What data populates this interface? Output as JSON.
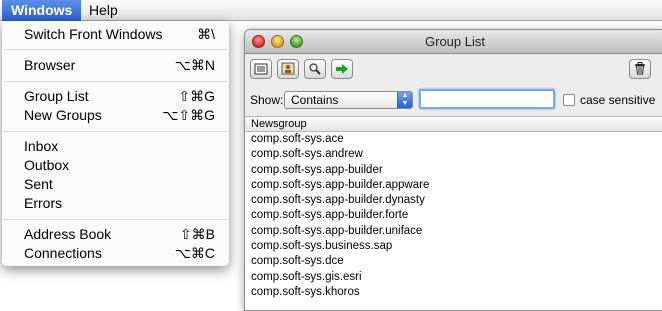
{
  "menubar": {
    "windows": "Windows",
    "help": "Help"
  },
  "window": {
    "title": "Group List",
    "show_label": "Show:",
    "show_value": "Contains",
    "search_value": "",
    "case_sensitive_label": "case sensitive",
    "column_header": "Newsgroup",
    "rows": [
      "comp.soft-sys.ace",
      "comp.soft-sys.andrew",
      "comp.soft-sys.app-builder",
      "comp.soft-sys.app-builder.appware",
      "comp.soft-sys.app-builder.dynasty",
      "comp.soft-sys.app-builder.forte",
      "comp.soft-sys.app-builder.uniface",
      "comp.soft-sys.business.sap",
      "comp.soft-sys.dce",
      "comp.soft-sys.gis.esri",
      "comp.soft-sys.khoros"
    ],
    "toolbar_icons": [
      "list-icon",
      "properties-icon",
      "magnifier-icon",
      "go-arrow-icon",
      "trash-icon"
    ]
  },
  "menu": {
    "items": [
      {
        "label": "Switch Front Windows",
        "shortcut": "⌘\\"
      },
      {
        "label": "Browser",
        "shortcut": "⌥⌘N"
      },
      {
        "label": "Group List",
        "shortcut": "⇧⌘G"
      },
      {
        "label": "New Groups",
        "shortcut": "⌥⇧⌘G"
      },
      {
        "label": "Inbox",
        "shortcut": ""
      },
      {
        "label": "Outbox",
        "shortcut": ""
      },
      {
        "label": "Sent",
        "shortcut": ""
      },
      {
        "label": "Errors",
        "shortcut": ""
      },
      {
        "label": "Address Book",
        "shortcut": "⇧⌘B"
      },
      {
        "label": "Connections",
        "shortcut": "⌥⌘C"
      }
    ]
  },
  "colors": {
    "menu_highlight": "#2a5fd4",
    "close": "#d52b1e",
    "minimize": "#d9a21b",
    "zoom": "#47a12a",
    "go_arrow": "#1aa31a"
  }
}
